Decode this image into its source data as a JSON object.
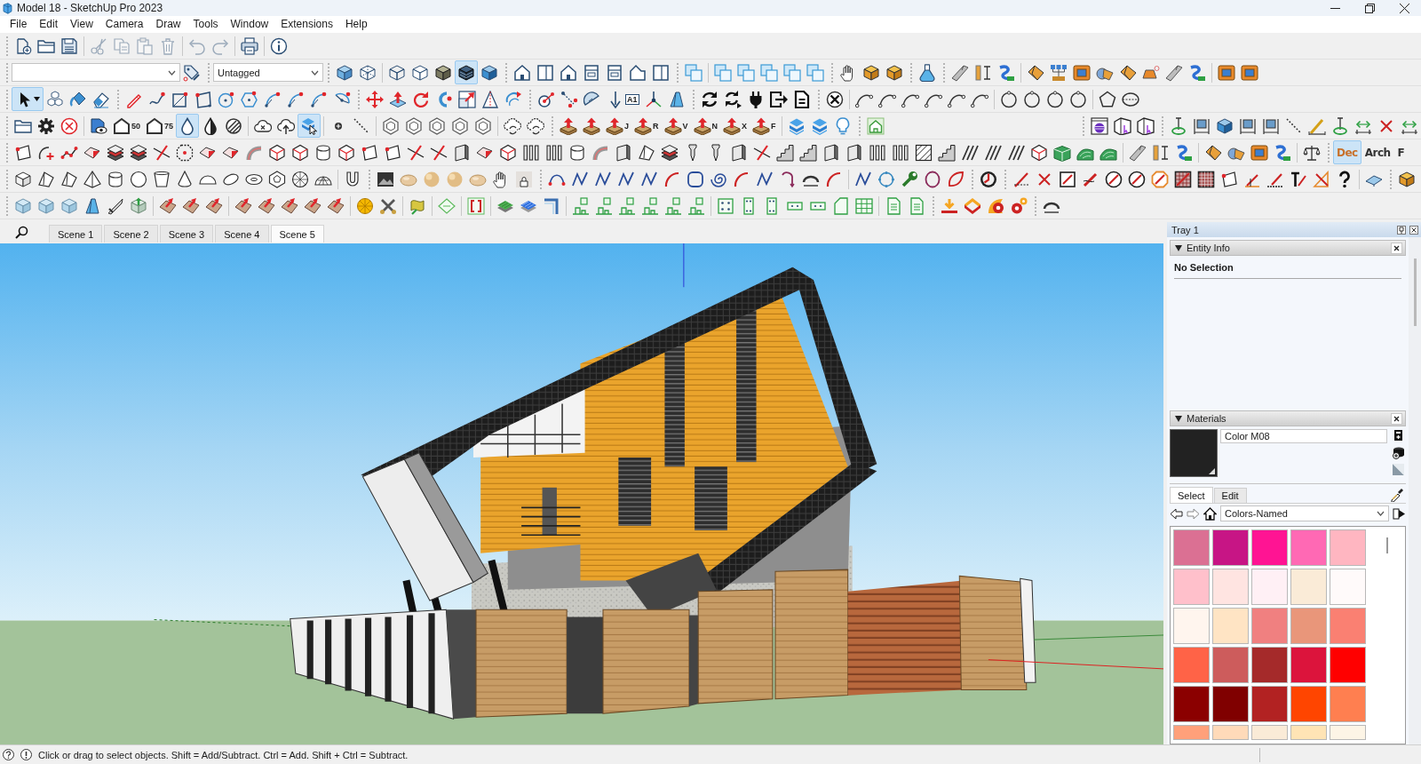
{
  "window": {
    "title": "Model 18 - SketchUp Pro 2023"
  },
  "menu": [
    "File",
    "Edit",
    "View",
    "Camera",
    "Draw",
    "Tools",
    "Window",
    "Extensions",
    "Help"
  ],
  "toolbar_rows": [
    {
      "items": [
        {
          "disabled": false
        },
        {
          "disabled": false
        },
        {
          "disabled": false
        },
        {
          "disabled": true
        },
        {
          "disabled": true
        },
        {
          "disabled": true
        },
        {
          "disabled": true
        },
        {
          "disabled": true
        },
        {
          "disabled": true
        },
        {
          "disabled": false
        },
        {
          "disabled": false
        }
      ]
    },
    {
      "tag_field": {
        "value": "Untagged"
      },
      "items": [
        {
          "selected": false
        },
        {
          "selected": false
        },
        {
          "selected": false
        },
        {
          "selected": false
        },
        {
          "selected": false
        },
        {
          "selected": false
        },
        {
          "selected": true
        },
        {
          "selected": false
        },
        {
          "selected": false
        },
        {
          "selected": false
        },
        {
          "selected": false
        },
        {
          "selected": false
        },
        {
          "selected": false
        },
        {
          "selected": false
        },
        {
          "selected": false
        },
        {
          "selected": false
        },
        {
          "selected": false
        },
        {
          "selected": false
        },
        {
          "selected": false
        },
        {
          "selected": false
        },
        {
          "selected": false
        },
        {
          "selected": false
        },
        {
          "selected": false
        },
        {
          "selected": false
        },
        {
          "selected": false
        },
        {
          "selected": false
        },
        {
          "selected": false
        },
        {
          "selected": false
        },
        {
          "selected": false
        },
        {
          "selected": false
        },
        {
          "selected": false
        },
        {
          "selected": false
        },
        {
          "selected": false
        },
        {
          "selected": false
        },
        {
          "selected": false
        },
        {
          "selected": false
        },
        {
          "selected": false
        },
        {
          "selected": false
        }
      ]
    },
    {
      "items": [
        {
          "selected": true
        },
        {
          "selected": false
        },
        {
          "selected": false
        },
        {
          "selected": false
        },
        {
          "selected": false
        },
        {
          "selected": false
        },
        {
          "selected": false
        },
        {
          "selected": false
        },
        {
          "selected": false
        },
        {
          "selected": false
        },
        {
          "selected": false
        },
        {
          "selected": false
        },
        {
          "selected": false
        },
        {
          "selected": false
        },
        {
          "selected": false
        },
        {
          "selected": false
        },
        {
          "selected": false
        },
        {
          "selected": false
        },
        {
          "selected": false
        },
        {
          "selected": false
        },
        {
          "selected": false
        },
        {
          "selected": false
        },
        {
          "selected": false
        },
        {
          "selected": false
        },
        {
          "selected": false,
          "label": "A1"
        },
        {
          "selected": false
        },
        {
          "selected": false
        },
        {
          "selected": false
        },
        {
          "selected": false
        },
        {
          "selected": false
        },
        {
          "selected": false
        },
        {
          "selected": false
        },
        {
          "selected": false
        },
        {
          "selected": false
        },
        {
          "selected": false
        },
        {
          "selected": false
        },
        {
          "selected": false
        },
        {
          "selected": false
        },
        {
          "selected": false
        },
        {
          "selected": false
        },
        {
          "selected": false
        },
        {
          "selected": false
        },
        {
          "selected": false
        },
        {
          "selected": false
        },
        {
          "selected": false
        }
      ]
    },
    {
      "items": [
        {
          "selected": false
        },
        {
          "selected": false
        },
        {
          "selected": false
        },
        {
          "selected": false
        },
        {
          "selected": false,
          "label": "50"
        },
        {
          "selected": false,
          "label": "75"
        },
        {
          "selected": true
        },
        {
          "selected": false
        },
        {
          "selected": false
        },
        {
          "selected": false
        },
        {
          "selected": false
        },
        {
          "selected": true
        },
        {
          "selected": false
        },
        {
          "selected": false
        },
        {
          "selected": false
        },
        {
          "selected": false
        },
        {
          "selected": false
        },
        {
          "selected": false
        },
        {
          "selected": false
        },
        {
          "selected": false
        },
        {
          "selected": false
        },
        {
          "selected": false
        },
        {
          "selected": false
        },
        {
          "selected": false,
          "label": "J"
        },
        {
          "selected": false,
          "label": "R"
        },
        {
          "selected": false,
          "label": "V"
        },
        {
          "selected": false,
          "label": "N"
        },
        {
          "selected": false,
          "label": "X"
        },
        {
          "selected": false,
          "label": "F"
        },
        {
          "selected": false
        },
        {
          "selected": false
        },
        {
          "selected": false
        },
        {
          "selected": false
        },
        {
          "selected": false
        },
        {
          "selected": false
        },
        {
          "selected": false
        },
        {
          "selected": false
        },
        {
          "selected": false
        },
        {
          "selected": false
        },
        {
          "selected": false
        },
        {
          "selected": false
        },
        {
          "selected": false
        },
        {
          "selected": false
        },
        {
          "selected": false
        },
        {
          "selected": false
        },
        {
          "selected": false
        },
        {
          "selected": false
        }
      ]
    },
    {
      "items": [
        {
          "selected": false
        },
        {
          "selected": false
        },
        {
          "selected": false
        },
        {
          "selected": false
        },
        {
          "selected": false
        },
        {
          "selected": false
        },
        {
          "selected": false
        },
        {
          "selected": false
        },
        {
          "selected": false
        },
        {
          "selected": false
        },
        {
          "selected": false
        },
        {
          "selected": false
        },
        {
          "selected": false
        },
        {
          "selected": false
        },
        {
          "selected": false
        },
        {
          "selected": false
        },
        {
          "selected": false
        },
        {
          "selected": false
        },
        {
          "selected": false
        },
        {
          "selected": false
        },
        {
          "selected": false
        },
        {
          "selected": false
        },
        {
          "selected": false
        },
        {
          "selected": false
        },
        {
          "selected": false
        },
        {
          "selected": false
        },
        {
          "selected": false
        },
        {
          "selected": false
        },
        {
          "selected": false
        },
        {
          "selected": false
        },
        {
          "selected": false
        },
        {
          "selected": false
        },
        {
          "selected": false
        },
        {
          "selected": false
        },
        {
          "selected": false
        },
        {
          "selected": false
        },
        {
          "selected": false
        },
        {
          "selected": false
        },
        {
          "selected": false
        },
        {
          "selected": false
        },
        {
          "selected": false
        },
        {
          "selected": false
        },
        {
          "selected": false
        },
        {
          "selected": false
        },
        {
          "selected": false
        },
        {
          "selected": false
        },
        {
          "selected": false
        },
        {
          "selected": false
        },
        {
          "selected": false
        },
        {
          "selected": false
        },
        {
          "selected": false
        },
        {
          "selected": false
        },
        {
          "selected": false
        },
        {
          "selected": false
        },
        {
          "selected": false
        },
        {
          "selected": false
        }
      ],
      "text_buttons": [
        {
          "label": "Dec",
          "selected": true
        },
        {
          "label": "Arch",
          "selected": false
        },
        {
          "label": "F",
          "selected": false
        }
      ]
    },
    {
      "items": [
        {
          "selected": false
        },
        {
          "selected": false
        },
        {
          "selected": false
        },
        {
          "selected": false
        },
        {
          "selected": false
        },
        {
          "selected": false
        },
        {
          "selected": false
        },
        {
          "selected": false
        },
        {
          "selected": false
        },
        {
          "selected": false
        },
        {
          "selected": false
        },
        {
          "selected": false
        },
        {
          "selected": false
        },
        {
          "selected": false
        },
        {
          "selected": false
        },
        {
          "selected": false
        },
        {
          "selected": false
        },
        {
          "selected": false
        },
        {
          "selected": false
        },
        {
          "selected": false
        },
        {
          "selected": false
        },
        {
          "selected": false
        },
        {
          "selected": false
        },
        {
          "selected": false
        },
        {
          "selected": false
        },
        {
          "selected": false
        },
        {
          "selected": false
        },
        {
          "selected": false
        },
        {
          "selected": false
        },
        {
          "selected": false
        },
        {
          "selected": false
        },
        {
          "selected": false
        },
        {
          "selected": false
        },
        {
          "selected": false
        },
        {
          "selected": false
        },
        {
          "selected": false
        },
        {
          "selected": false
        },
        {
          "selected": false
        },
        {
          "selected": false
        },
        {
          "selected": false
        },
        {
          "selected": false
        },
        {
          "selected": false
        },
        {
          "selected": false
        },
        {
          "selected": false
        },
        {
          "selected": false
        },
        {
          "selected": false
        },
        {
          "selected": false
        },
        {
          "selected": false
        },
        {
          "selected": false
        },
        {
          "selected": false
        },
        {
          "selected": false
        },
        {
          "selected": false
        },
        {
          "selected": false
        },
        {
          "selected": false
        },
        {
          "selected": false
        },
        {
          "selected": false
        },
        {
          "selected": false
        },
        {
          "selected": false
        }
      ]
    },
    {
      "items": [
        {
          "selected": false
        },
        {
          "selected": false
        },
        {
          "selected": false
        },
        {
          "selected": false
        },
        {
          "selected": false
        },
        {
          "selected": false
        },
        {
          "selected": false
        },
        {
          "selected": false
        },
        {
          "selected": false
        },
        {
          "selected": false
        },
        {
          "selected": false
        },
        {
          "selected": false
        },
        {
          "selected": false
        },
        {
          "selected": false
        },
        {
          "selected": false
        },
        {
          "selected": false
        },
        {
          "selected": false
        },
        {
          "selected": false
        },
        {
          "selected": false
        },
        {
          "selected": false
        },
        {
          "selected": false
        },
        {
          "selected": false
        },
        {
          "selected": false
        },
        {
          "selected": false
        },
        {
          "selected": false
        },
        {
          "selected": false
        },
        {
          "selected": false
        },
        {
          "selected": false
        },
        {
          "selected": false
        },
        {
          "selected": false
        },
        {
          "selected": false
        },
        {
          "selected": false
        },
        {
          "selected": false
        },
        {
          "selected": false
        },
        {
          "selected": false
        },
        {
          "selected": false
        },
        {
          "selected": false
        },
        {
          "selected": false
        },
        {
          "selected": false
        },
        {
          "selected": false
        },
        {
          "selected": false
        },
        {
          "selected": false
        }
      ]
    }
  ],
  "scenes": [
    {
      "label": "Scene 1",
      "selected": false
    },
    {
      "label": "Scene 2",
      "selected": false
    },
    {
      "label": "Scene 3",
      "selected": false
    },
    {
      "label": "Scene 4",
      "selected": false
    },
    {
      "label": "Scene 5",
      "selected": true
    }
  ],
  "tray": {
    "title": "Tray 1",
    "entity_info": {
      "title": "Entity Info",
      "status": "No Selection"
    },
    "materials": {
      "title": "Materials",
      "name": "Color M08",
      "tabs": [
        {
          "label": "Select",
          "selected": true
        },
        {
          "label": "Edit",
          "selected": false
        }
      ],
      "collection": "Colors-Named",
      "swatches": [
        {
          "color": "#db7093"
        },
        {
          "color": "#c71585"
        },
        {
          "color": "#ff1493"
        },
        {
          "color": "#ff69b4"
        },
        {
          "color": "#ffb6c1"
        },
        {
          "color": "#ffc0cb"
        },
        {
          "color": "#ffe4e1"
        },
        {
          "color": "#fff0f5"
        },
        {
          "color": "#faebd7"
        },
        {
          "color": "#fffafa"
        },
        {
          "color": "#fff5ee"
        },
        {
          "color": "#ffe4c4"
        },
        {
          "color": "#f08080"
        },
        {
          "color": "#e9967a"
        },
        {
          "color": "#fa8072"
        },
        {
          "color": "#ff6347"
        },
        {
          "color": "#cd5c5c"
        },
        {
          "color": "#a52a2a"
        },
        {
          "color": "#dc143c"
        },
        {
          "color": "#ff0000"
        },
        {
          "color": "#8b0000"
        },
        {
          "color": "#800000"
        },
        {
          "color": "#b22222"
        },
        {
          "color": "#ff4500"
        },
        {
          "color": "#ff7f50"
        },
        {
          "color": "#ffa07a"
        },
        {
          "color": "#ffdab9"
        },
        {
          "color": "#faebd7"
        },
        {
          "color": "#ffe4b5"
        },
        {
          "color": "#fdf5e6"
        }
      ]
    }
  },
  "status_bar": {
    "text": "Click or drag to select objects. Shift = Add/Subtract. Ctrl = Add. Shift + Ctrl = Subtract."
  }
}
